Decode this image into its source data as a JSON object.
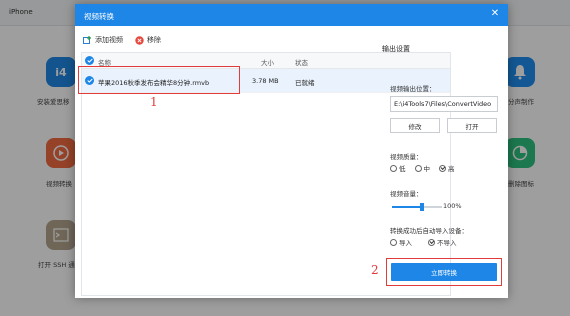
{
  "background": {
    "tab_label": "iPhone",
    "left_labels": [
      "安装爱思移",
      "视频转换",
      "打开 SSH 通"
    ],
    "right_labels": [
      "分声制作",
      "删除图标"
    ]
  },
  "dialog": {
    "title": "视频转换",
    "toolbar": {
      "add_label": "添加视频",
      "remove_label": "移除"
    },
    "list": {
      "columns": {
        "name": "名称",
        "size": "大小",
        "status": "状态"
      },
      "rows": [
        {
          "name": "苹果2016秋季发布会精华8分钟.rmvb",
          "size": "3.78 MB",
          "status": "已就绪"
        }
      ]
    },
    "settings": {
      "title": "输出设置",
      "output_location_label": "视频输出位置：",
      "output_path": "E:\\i4Tools7\\Files\\ConvertVideo",
      "modify_label": "修改",
      "open_label": "打开",
      "quality_label": "视频质量：",
      "quality_options": [
        "低",
        "中",
        "高"
      ],
      "quality_selected": "高",
      "volume_label": "视频音量：",
      "volume_value": "100%",
      "volume_fraction": 0.6,
      "auto_import_label": "转换成功后自动导入设备：",
      "import_options": [
        "导入",
        "不导入"
      ],
      "import_selected": "不导入",
      "convert_label": "立即转换"
    },
    "markers": {
      "one": "1",
      "two": "2"
    }
  },
  "colors": {
    "accent": "#1e86e6",
    "highlight": "#e23b3b"
  }
}
